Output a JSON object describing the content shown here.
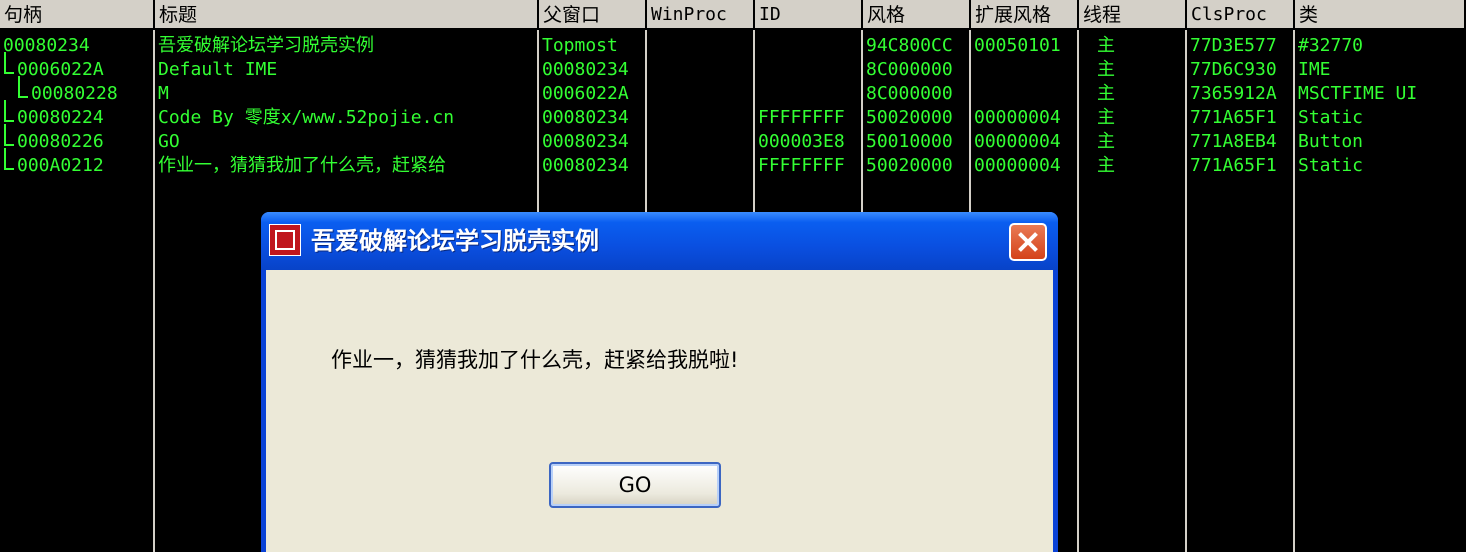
{
  "columns": [
    "句柄",
    "标题",
    "父窗口",
    "WinProc",
    "ID",
    "风格",
    "扩展风格",
    "线程",
    "ClsProc",
    "类"
  ],
  "rows": [
    {
      "handle": "00080234",
      "title": "吾爱破解论坛学习脱壳实例",
      "parent": "Topmost",
      "winproc": "",
      "id": "",
      "style": "94C800CC",
      "exstyle": "00050101",
      "thread": "主",
      "clsproc": "77D3E577",
      "cls": "#32770"
    },
    {
      "handle": "0006022A",
      "title": "Default IME",
      "parent": "00080234",
      "winproc": "",
      "id": "",
      "style": "8C000000",
      "exstyle": "",
      "thread": "主",
      "clsproc": "77D6C930",
      "cls": "IME"
    },
    {
      "handle": "00080228",
      "title": "M",
      "parent": "0006022A",
      "winproc": "",
      "id": "",
      "style": "8C000000",
      "exstyle": "",
      "thread": "主",
      "clsproc": "7365912A",
      "cls": "MSCTFIME UI"
    },
    {
      "handle": "00080224",
      "title": "Code By 零度x/www.52pojie.cn",
      "parent": "00080234",
      "winproc": "",
      "id": "FFFFFFFF",
      "style": "50020000",
      "exstyle": "00000004",
      "thread": "主",
      "clsproc": "771A65F1",
      "cls": "Static"
    },
    {
      "handle": "00080226",
      "title": "GO",
      "parent": "00080234",
      "winproc": "",
      "id": "000003E8",
      "style": "50010000",
      "exstyle": "00000004",
      "thread": "主",
      "clsproc": "771A8EB4",
      "cls": "Button"
    },
    {
      "handle": "000A0212",
      "title": "作业一，猜猜我加了什么壳，赶紧给",
      "parent": "00080234",
      "winproc": "",
      "id": "FFFFFFFF",
      "style": "50020000",
      "exstyle": "00000004",
      "thread": "主",
      "clsproc": "771A65F1",
      "cls": "Static"
    }
  ],
  "dialog": {
    "title": "吾爱破解论坛学习脱壳实例",
    "message": "作业一，猜猜我加了什么壳，赶紧给我脱啦!",
    "button_label": "GO",
    "icon": "app-seal-icon",
    "close_icon": "close-icon"
  },
  "colors": {
    "grid_text": "#33ff33",
    "background": "#000000",
    "header": "#d4d0c8",
    "titlebar": "#0a4fe0",
    "dialog_client": "#ece9d8"
  }
}
